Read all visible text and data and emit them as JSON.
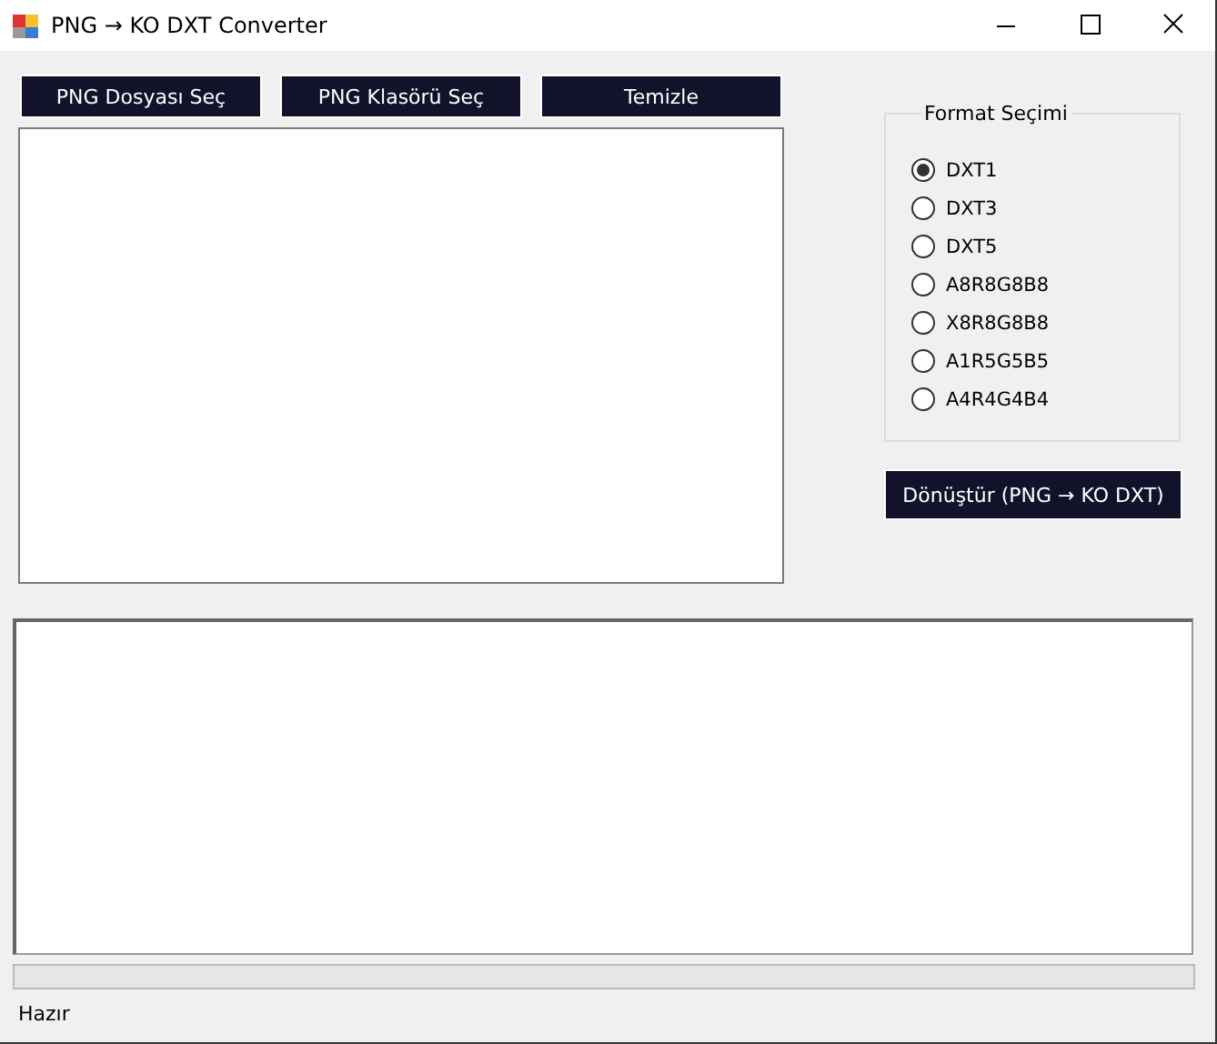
{
  "window": {
    "title": "PNG → KO DXT Converter"
  },
  "buttons": [
    "PNG Dosyası Seç",
    "PNG Klasörü Seç",
    "Temizle"
  ],
  "format_group": {
    "title": "Format Seçimi",
    "options": [
      {
        "label": "DXT1",
        "selected": true
      },
      {
        "label": "DXT3",
        "selected": false
      },
      {
        "label": "DXT5",
        "selected": false
      },
      {
        "label": "A8R8G8B8",
        "selected": false
      },
      {
        "label": "X8R8G8B8",
        "selected": false
      },
      {
        "label": "A1R5G5B5",
        "selected": false
      },
      {
        "label": "A4R4G4B4",
        "selected": false
      }
    ]
  },
  "convert_button": "Dönüştür (PNG → KO DXT)",
  "status_bar": "Hazır"
}
